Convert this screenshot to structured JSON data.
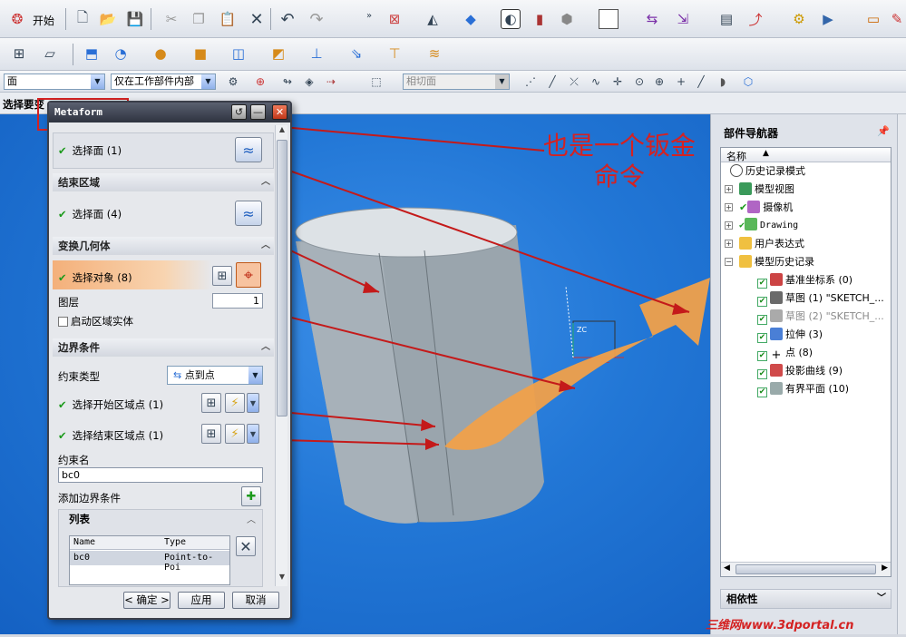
{
  "toolbar1": {
    "start_label": "开始"
  },
  "toolbar3": {
    "filter_value": "面",
    "scope_value": "仅在工作部件内部",
    "snap_value": "相切面"
  },
  "status": {
    "select_prompt": "选择要变"
  },
  "dialog": {
    "title": "Metaform",
    "sec1_row": "选择面 (1)",
    "sec2_title": "结束区域",
    "sec2_row": "选择面 (4)",
    "sec3_title": "变换几何体",
    "sec3_row": "选择对象 (8)",
    "layer_label": "图层",
    "layer_value": "1",
    "region_solid": "启动区域实体",
    "sec4_title": "边界条件",
    "constraint_type_label": "约束类型",
    "constraint_type_value": "点到点",
    "start_point": "选择开始区域点 (1)",
    "end_point": "选择结束区域点 (1)",
    "constraint_name_label": "约束名",
    "constraint_name_value": "bc0",
    "add_boundary": "添加边界条件",
    "list_title": "列表",
    "list_headers": [
      "Name",
      "Type"
    ],
    "list_row": [
      "bc0",
      "Point-to-Poi"
    ],
    "ok": "< 确定 >",
    "apply": "应用",
    "cancel": "取消"
  },
  "annotation": {
    "text": "也是一个钣金命令"
  },
  "navigator": {
    "title": "部件导航器",
    "column": "名称",
    "items": [
      "历史记录模式",
      "模型视图",
      "摄像机",
      "Drawing",
      "用户表达式",
      "模型历史记录",
      "基准坐标系 (0)",
      "草图 (1) \"SKETCH_...",
      "草图 (2) \"SKETCH_...",
      "拉伸 (3)",
      "点 (8)",
      "投影曲线 (9)",
      "有界平面 (10)"
    ],
    "dependency": "相依性"
  },
  "watermark": "三维网www.3dportal.cn",
  "colors": {
    "accent": "#e8a24a",
    "annotation": "#d42222",
    "viewport": "#2277d6"
  }
}
